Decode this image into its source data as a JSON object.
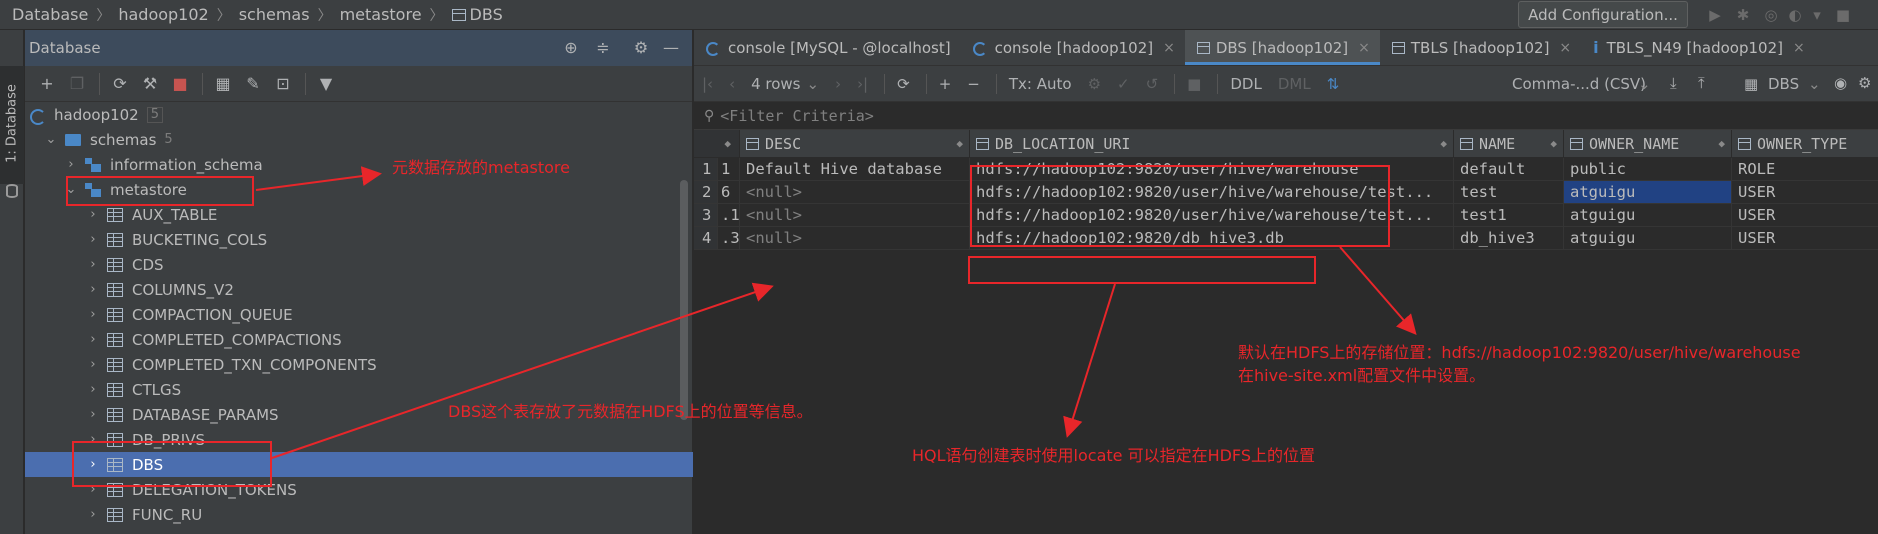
{
  "breadcrumb": [
    "Database",
    "hadoop102",
    "schemas",
    "metastore",
    "DBS"
  ],
  "toolbar": {
    "add_configuration": "Add Configuration..."
  },
  "sidebar": {
    "tab_label": "1: Database"
  },
  "db_panel": {
    "title": "Database",
    "tree": {
      "connection": {
        "label": "hadoop102",
        "count": "5"
      },
      "schemas": {
        "label": "schemas",
        "count": "5"
      },
      "information_schema": "information_schema",
      "metastore": "metastore",
      "tables": [
        "AUX_TABLE",
        "BUCKETING_COLS",
        "CDS",
        "COLUMNS_V2",
        "COMPACTION_QUEUE",
        "COMPLETED_COMPACTIONS",
        "COMPLETED_TXN_COMPONENTS",
        "CTLGS",
        "DATABASE_PARAMS",
        "DB_PRIVS",
        "DBS",
        "DELEGATION_TOKENS",
        "FUNC_RU"
      ],
      "selected_table": "DBS"
    }
  },
  "tabs": [
    {
      "label": "console [MySQL - @localhost]",
      "icon": "console-icon"
    },
    {
      "label": "console [hadoop102]",
      "icon": "console-icon"
    },
    {
      "label": "DBS [hadoop102]",
      "icon": "table-icon",
      "active": true
    },
    {
      "label": "TBLS [hadoop102]",
      "icon": "table-icon"
    },
    {
      "label": "TBLS_N49 [hadoop102]",
      "icon": "info-icon"
    }
  ],
  "grid_toolbar": {
    "rows_label": "4 rows",
    "tx_label": "Tx: Auto",
    "ddl_label": "DDL",
    "dml_label": "DML",
    "export_format": "Comma-...d (CSV)",
    "target": "DBS"
  },
  "filter": {
    "placeholder": "<Filter Criteria>"
  },
  "grid": {
    "columns": [
      "DESC",
      "DB_LOCATION_URI",
      "NAME",
      "OWNER_NAME",
      "OWNER_TYPE"
    ],
    "rows": [
      {
        "row": "1",
        "id": "1",
        "desc": "Default Hive database",
        "uri": "hdfs://hadoop102:9820/user/hive/warehouse",
        "name": "default",
        "owner": "public",
        "type": "ROLE"
      },
      {
        "row": "2",
        "id": "6",
        "desc": "<null>",
        "uri": "hdfs://hadoop102:9820/user/hive/warehouse/test...",
        "name": "test",
        "owner": "atguigu",
        "type": "USER"
      },
      {
        "row": "3",
        "id": ".1",
        "desc": "<null>",
        "uri": "hdfs://hadoop102:9820/user/hive/warehouse/test...",
        "name": "test1",
        "owner": "atguigu",
        "type": "USER"
      },
      {
        "row": "4",
        "id": ".3",
        "desc": "<null>",
        "uri": "hdfs://hadoop102:9820/db_hive3.db",
        "name": "db_hive3",
        "owner": "atguigu",
        "type": "USER"
      }
    ]
  },
  "annotations": {
    "metastore_note": "元数据存放的metastore",
    "dbs_note": "DBS这个表存放了元数据在HDFS上的位置等信息。",
    "default_location_line1": "默认在HDFS上的存储位置：hdfs://hadoop102:9820/user/hive/warehouse",
    "default_location_line2": "在hive-site.xml配置文件中设置。",
    "hql_note": "HQL语句创建表时使用locate 可以指定在HDFS上的位置"
  },
  "colors": {
    "annotation": "#e8262a",
    "selection": "#4b6eaf",
    "accent": "#4a88c7"
  }
}
